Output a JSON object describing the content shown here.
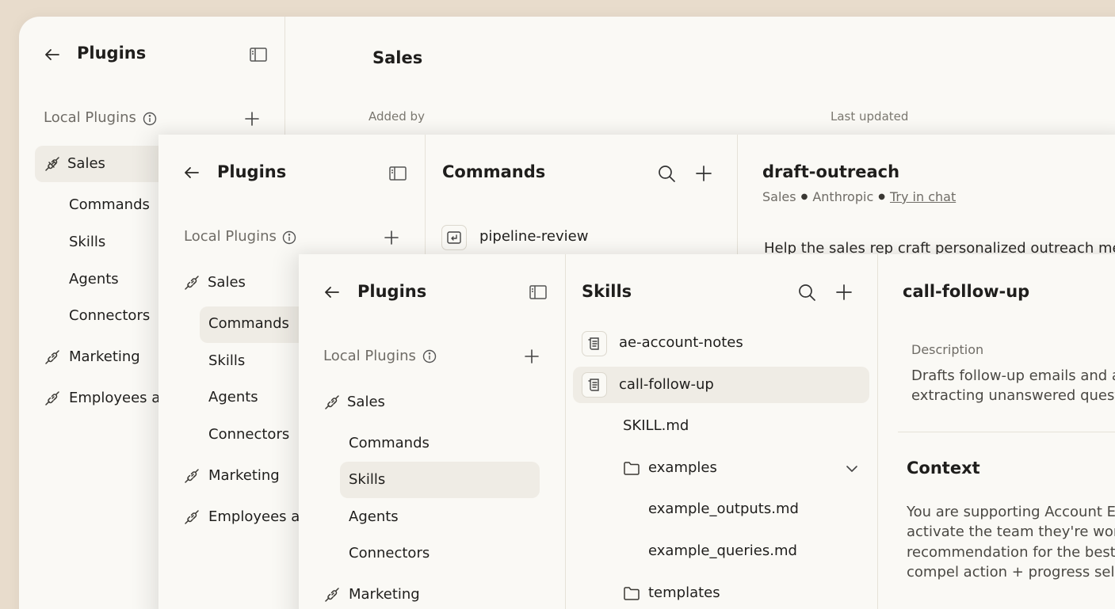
{
  "panel1": {
    "sidebar": {
      "title": "Plugins",
      "section_label": "Local Plugins",
      "plugins": [
        {
          "label": "Sales",
          "children": [
            "Commands",
            "Skills",
            "Agents",
            "Connectors"
          ]
        },
        {
          "label": "Marketing"
        },
        {
          "label": "Employees at"
        }
      ]
    },
    "main": {
      "title": "Sales",
      "col_added_by": "Added by",
      "col_last_updated": "Last updated"
    }
  },
  "panel2": {
    "sidebar": {
      "title": "Plugins",
      "section_label": "Local Plugins",
      "plugins": [
        {
          "label": "Sales",
          "children": [
            "Commands",
            "Skills",
            "Agents",
            "Connectors"
          ]
        },
        {
          "label": "Marketing"
        },
        {
          "label": "Employees at"
        }
      ]
    },
    "list": {
      "title": "Commands",
      "items": [
        "pipeline-review"
      ]
    },
    "detail": {
      "title": "draft-outreach",
      "meta_plugin": "Sales",
      "meta_author": "Anthropic",
      "meta_link": "Try in chat",
      "description": "Help the sales rep craft personalized outreach mes"
    }
  },
  "panel3": {
    "sidebar": {
      "title": "Plugins",
      "section_label": "Local Plugins",
      "plugins": [
        {
          "label": "Sales",
          "children": [
            "Commands",
            "Skills",
            "Agents",
            "Connectors"
          ]
        },
        {
          "label": "Marketing"
        }
      ]
    },
    "list": {
      "title": "Skills",
      "items": [
        "ae-account-notes",
        "call-follow-up"
      ],
      "tree": {
        "file_root": "SKILL.md",
        "folder_examples": "examples",
        "examples_files": [
          "example_outputs.md",
          "example_queries.md"
        ],
        "folder_templates": "templates"
      }
    },
    "detail": {
      "title": "call-follow-up",
      "description_label": "Description",
      "description_lines": [
        "Drafts follow-up emails and ar",
        "extracting unanswered quest"
      ],
      "context_heading": "Context",
      "context_lines": [
        "You are supporting Account Ex",
        "activate the team they're work",
        "recommendation for the best p",
        "compel action + progress sellin"
      ]
    }
  },
  "colors": {
    "background": "#e8dccc",
    "panel": "#faf9f5",
    "selected": "#efece5",
    "text": "#1f1e1c",
    "muted": "#6f6c66"
  }
}
